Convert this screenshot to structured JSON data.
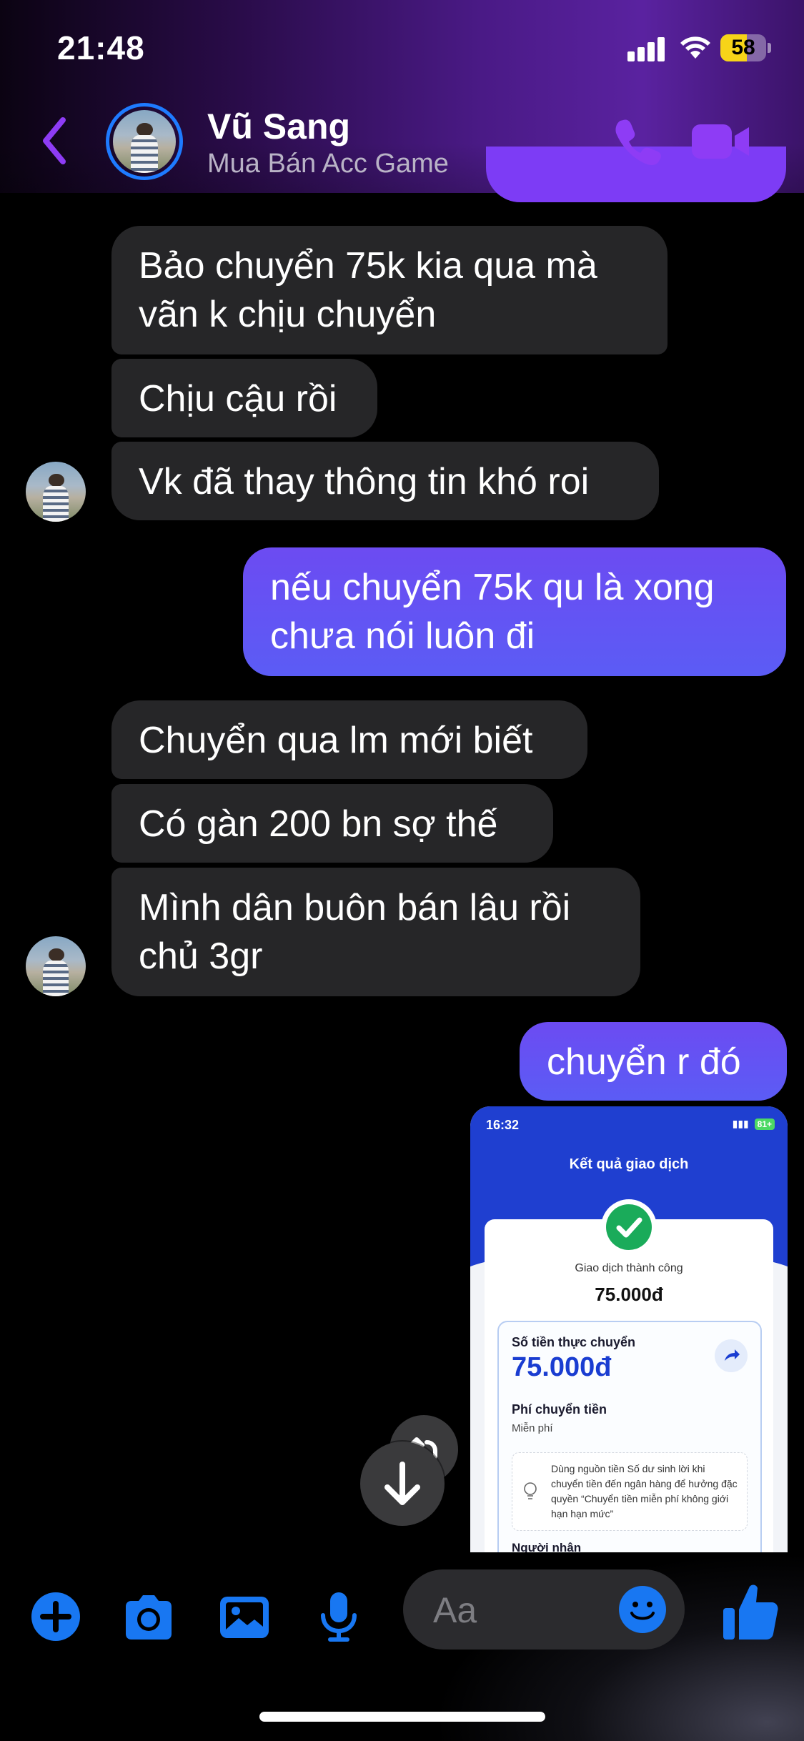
{
  "status_bar": {
    "time": "21:48",
    "battery": "58"
  },
  "header": {
    "contact_name": "Vũ Sang",
    "contact_subtitle": "Mua Bán Acc Game",
    "accent_color": "#8e3cf5"
  },
  "messages": [
    {
      "side": "in",
      "text": "Bảo chuyển 75k kia qua mà\nvãn k chịu chuyển"
    },
    {
      "side": "in",
      "text": "Chịu cậu rồi"
    },
    {
      "side": "in",
      "text": "Vk đã thay thông tin khó roi"
    },
    {
      "side": "out",
      "text": "nếu chuyển 75k qu là xong\nchưa nói luôn đi"
    },
    {
      "side": "in",
      "text": "Chuyển qua lm mới biết"
    },
    {
      "side": "in",
      "text": "Có gàn 200 bn sợ thế"
    },
    {
      "side": "in",
      "text": "Mình dân buôn bán lâu rồi\nchủ 3gr"
    },
    {
      "side": "out",
      "text": "chuyển r đó"
    }
  ],
  "receipt": {
    "time": "16:32",
    "battery": "81+",
    "title": "Kết quả giao dịch",
    "status": "Giao dịch thành công",
    "amount": "75.000đ",
    "actual_label": "Số tiền thực chuyển",
    "actual_amount": "75.000đ",
    "fee_label": "Phí chuyển tiền",
    "fee_value": "Miễn phí",
    "note": "Dùng nguồn tiền Số dư sinh lời khi chuyển tiền đến ngân hàng để hưởng đặc quyền “Chuyển tiền miễn phí không giới hạn hạn mức”",
    "recipient_label": "Người nhận"
  },
  "composer": {
    "placeholder": "Aa"
  },
  "colors": {
    "background": "#000000",
    "incoming_bubble": "#262628",
    "outgoing_bubble": "#6c4bf2",
    "toolbar_icon": "#1877f2"
  }
}
